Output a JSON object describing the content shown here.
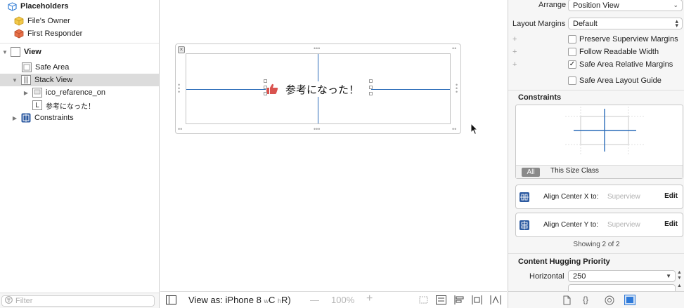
{
  "outline": {
    "placeholders_label": "Placeholders",
    "files_owner": "File's Owner",
    "first_responder": "First Responder",
    "view": "View",
    "safe_area": "Safe Area",
    "stack_view": "Stack View",
    "image_item": "ico_refarence_on",
    "label_item": "参考になった！",
    "constraints": "Constraints",
    "label_icon_glyph": "L",
    "filter_placeholder": "Filter"
  },
  "canvas": {
    "stack_text": "参考になった！",
    "device_prefix": "View as: iPhone 8",
    "size_class_w": "C",
    "size_class_h": "R",
    "size_class_w_prefix": "w",
    "size_class_h_prefix": "h",
    "zoom_minus": "—",
    "zoom_level": "100%",
    "zoom_plus": "+"
  },
  "inspector": {
    "arrange_label": "Arrange",
    "arrange_value": "Position View",
    "layout_margins_label": "Layout Margins",
    "layout_margins_value": "Default",
    "checks": [
      {
        "label": "Preserve Superview Margins",
        "checked": false
      },
      {
        "label": "Follow Readable Width",
        "checked": false
      },
      {
        "label": "Safe Area Relative Margins",
        "checked": true
      },
      {
        "label": "Safe Area Layout Guide",
        "checked": false
      }
    ],
    "plus": "+",
    "constraints_header": "Constraints",
    "tab_all": "All",
    "tab_size_class": "This Size Class",
    "constraint_items": [
      {
        "name": "Align Center X to:",
        "target": "Superview",
        "action": "Edit"
      },
      {
        "name": "Align Center Y to:",
        "target": "Superview",
        "action": "Edit"
      }
    ],
    "showing": "Showing 2 of 2",
    "hugging_header": "Content Hugging Priority",
    "horizontal_label": "Horizontal",
    "horizontal_value": "250"
  },
  "colors": {
    "guide_blue": "#2a6bb8",
    "selection_gray": "#dcdcdc",
    "constraint_icon_blue": "#2c5aa0",
    "placeholder_icon_yellow": "#f3c94b",
    "first_responder_orange": "#e8714a",
    "thumb_red": "#d9534f"
  }
}
